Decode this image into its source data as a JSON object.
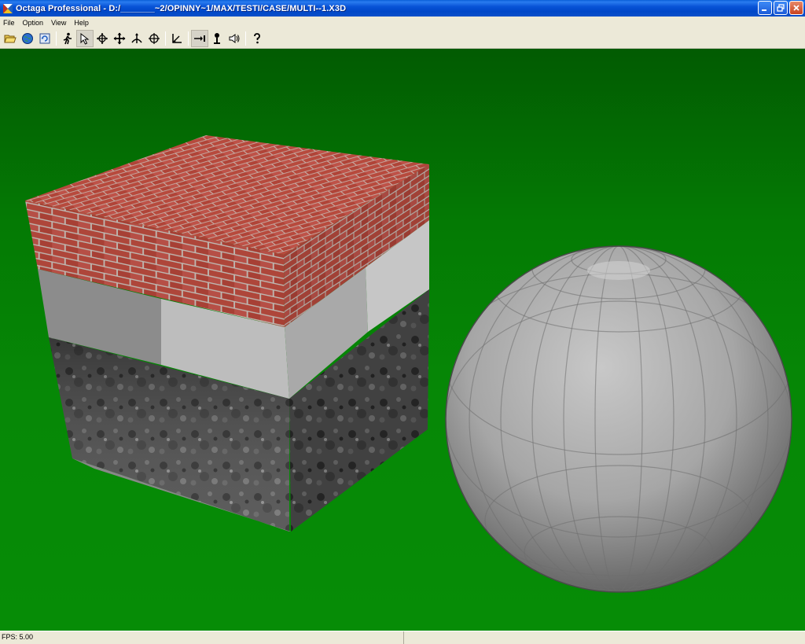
{
  "window": {
    "title": "Octaga Professional - D:/_______~2/OPINNY~1/MAX/TESTI/CASE/MULTI--1.X3D",
    "titlebar_color": "#0853d6"
  },
  "menu": {
    "items": [
      {
        "label": "File"
      },
      {
        "label": "Option"
      },
      {
        "label": "View"
      },
      {
        "label": "Help"
      }
    ]
  },
  "toolbar": {
    "buttons": [
      {
        "icon": "open-folder-icon"
      },
      {
        "icon": "globe-icon"
      },
      {
        "icon": "reload-icon"
      },
      {
        "icon": "walk-icon"
      },
      {
        "icon": "select-arrow-icon"
      },
      {
        "icon": "examine-icon"
      },
      {
        "icon": "pan-icon"
      },
      {
        "icon": "fly-icon"
      },
      {
        "icon": "crosshair-icon"
      },
      {
        "icon": "axis-icon"
      },
      {
        "icon": "goto-icon"
      },
      {
        "icon": "headlight-icon"
      },
      {
        "icon": "sound-icon"
      },
      {
        "icon": "help-icon"
      }
    ]
  },
  "scene": {
    "background_color": "#068806",
    "brick_color": "#b84a3e",
    "sphere_color": "#a9a9a9"
  },
  "status": {
    "fps_text": "FPS: 5.00"
  }
}
